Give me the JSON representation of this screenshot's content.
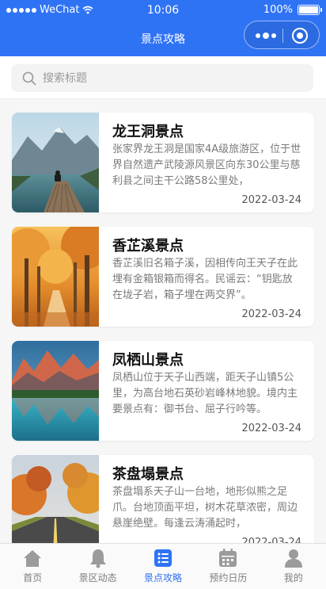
{
  "status_bar": {
    "carrier": "WeChat",
    "time": "10:06",
    "battery": "100%"
  },
  "navbar": {
    "title": "景点攻略"
  },
  "search": {
    "placeholder": "搜索标题",
    "value": ""
  },
  "spots": [
    {
      "name": "龙王洞景点",
      "desc": "张家界龙王洞是国家4A级旅游区，位于世界自然遗产武陵源风景区向东30公里与慈利县之间主干公路58公里处，",
      "date": "2022-03-24"
    },
    {
      "name": "香芷溪景点",
      "desc": "香芷溪旧名箱子溪，因相传向王天子在此埋有金箱银箱而得名。民谣云：“钥匙放在垅子岩，箱子埋在两交界”。",
      "date": "2022-03-24"
    },
    {
      "name": "凤栖山景点",
      "desc": "凤栖山位于天子山西端，距天子山镇5公里，为高台地石英砂岩峰林地貌。境内主要景点有：御书台、屈子行吟等。",
      "date": "2022-03-24"
    },
    {
      "name": "茶盘塌景点",
      "desc": "茶盘塌系天子山一台地，地形似熊之足爪。台地顶面平坦，树木花草浓密，周边悬崖绝壁。每逢云涛涌起时，",
      "date": "2022-03-24"
    }
  ],
  "tabs": [
    {
      "label": "首页",
      "icon": "home-icon",
      "active": false
    },
    {
      "label": "景区动态",
      "icon": "bell-icon",
      "active": false
    },
    {
      "label": "景点攻略",
      "icon": "list-icon",
      "active": true
    },
    {
      "label": "预约日历",
      "icon": "calendar-icon",
      "active": false
    },
    {
      "label": "我的",
      "icon": "user-icon",
      "active": false
    }
  ],
  "colors": {
    "primary": "#2f73f5",
    "tab_inactive": "#7d7d7d",
    "background": "#f6f6f6"
  }
}
